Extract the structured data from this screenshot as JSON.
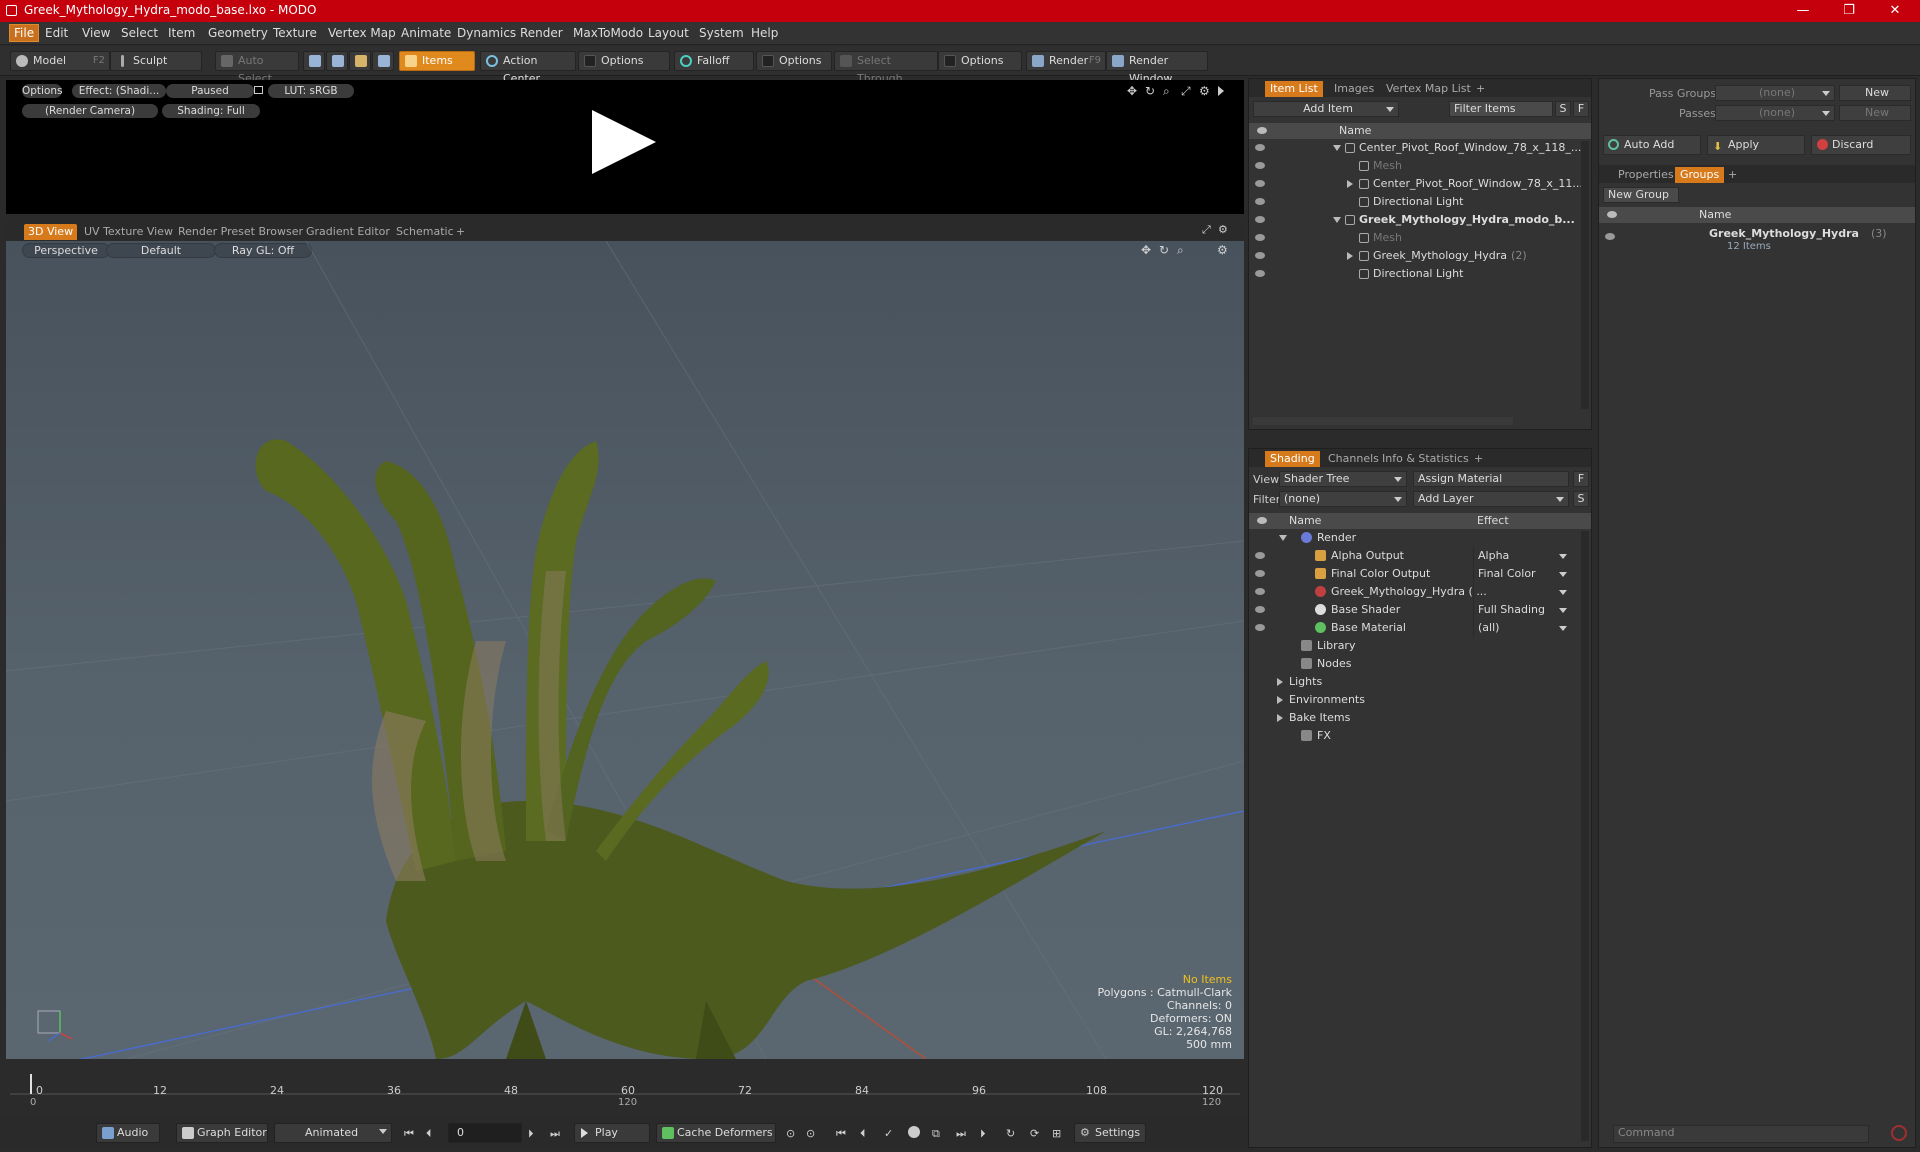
{
  "window": {
    "title": "Greek_Mythology_Hydra_modo_base.lxo - MODO",
    "minimize": "—",
    "restore": "❐",
    "close": "✕"
  },
  "menu": [
    "File",
    "Edit",
    "View",
    "Select",
    "Item",
    "Geometry",
    "Texture",
    "Vertex Map",
    "Animate",
    "Dynamics",
    "Render",
    "MaxToModo",
    "Layout",
    "System",
    "Help"
  ],
  "toolbar": {
    "model": "Model",
    "model_key": "F2",
    "sculpt": "Sculpt",
    "auto_select": "Auto Select",
    "items": "Items",
    "action_center": "Action Center",
    "options1": "Options",
    "falloff": "Falloff",
    "options2": "Options",
    "select_through": "Select Through",
    "options3": "Options",
    "render": "Render",
    "render_key": "F9",
    "render_window": "Render Window"
  },
  "preview": {
    "options": "Options",
    "effect": "Effect: (Shadi...",
    "paused": "Paused",
    "lut": "LUT: sRGB",
    "camera": "(Render Camera)",
    "shading": "Shading: Full"
  },
  "view_tabs": [
    "3D View",
    "UV Texture View",
    "Render Preset Browser",
    "Gradient Editor",
    "Schematic",
    "+"
  ],
  "viewport": {
    "perspective": "Perspective",
    "default": "Default",
    "raygl": "Ray GL: Off",
    "stats": {
      "no_items": "No Items",
      "polygons": "Polygons : Catmull-Clark",
      "channels": "Channels: 0",
      "deformers": "Deformers: ON",
      "gl": "GL: 2,264,768",
      "scale": "500 mm"
    }
  },
  "timeline": {
    "ticks": [
      "0",
      "12",
      "24",
      "36",
      "48",
      "60",
      "72",
      "84",
      "96",
      "108",
      "120"
    ],
    "start": "0",
    "mid": "120",
    "end": "120"
  },
  "bottom": {
    "audio": "Audio",
    "graph_editor": "Graph Editor",
    "animated": "Animated",
    "frame": "0",
    "play": "Play",
    "cache": "Cache Deformers",
    "settings": "Settings"
  },
  "item_list": {
    "tabs": [
      "Item List",
      "Images",
      "Vertex Map List",
      "+"
    ],
    "add_item": "Add Item",
    "filter_items": "Filter Items",
    "s": "S",
    "f": "F",
    "name_col": "Name",
    "rows": [
      {
        "label": "Center_Pivot_Roof_Window_78_x_118_...",
        "indent": 1,
        "bold": false
      },
      {
        "label": "Mesh",
        "indent": 2,
        "bold": false,
        "dim": true
      },
      {
        "label": "Center_Pivot_Roof_Window_78_x_11...",
        "indent": 2,
        "bold": false
      },
      {
        "label": "Directional Light",
        "indent": 2,
        "bold": false
      },
      {
        "label": "Greek_Mythology_Hydra_modo_b...",
        "indent": 1,
        "bold": true
      },
      {
        "label": "Mesh",
        "indent": 2,
        "bold": false,
        "dim": true
      },
      {
        "label": "Greek_Mythology_Hydra",
        "suffix": "(2)",
        "indent": 2,
        "bold": false
      },
      {
        "label": "Directional Light",
        "indent": 2,
        "bold": false
      }
    ]
  },
  "shading": {
    "tabs": [
      "Shading",
      "Channels",
      "Info & Statistics",
      "+"
    ],
    "view_label": "View",
    "view_value": "Shader Tree",
    "assign": "Assign Material",
    "f": "F",
    "filter_label": "Filter",
    "filter_value": "(none)",
    "add_layer": "Add Layer",
    "s": "S",
    "col_name": "Name",
    "col_effect": "Effect",
    "rows": [
      {
        "label": "Render",
        "effect": "",
        "indent": 0
      },
      {
        "label": "Alpha Output",
        "effect": "Alpha",
        "indent": 1
      },
      {
        "label": "Final Color Output",
        "effect": "Final Color",
        "indent": 1
      },
      {
        "label": "Greek_Mythology_Hydra ( ...",
        "effect": "",
        "indent": 1
      },
      {
        "label": "Base Shader",
        "effect": "Full Shading",
        "indent": 1
      },
      {
        "label": "Base Material",
        "effect": "(all)",
        "indent": 1
      },
      {
        "label": "Library",
        "effect": "",
        "indent": 0
      },
      {
        "label": "Nodes",
        "effect": "",
        "indent": 0
      },
      {
        "label": "Lights",
        "effect": "",
        "indent": -1
      },
      {
        "label": "Environments",
        "effect": "",
        "indent": -1
      },
      {
        "label": "Bake Items",
        "effect": "",
        "indent": -1
      },
      {
        "label": "FX",
        "effect": "",
        "indent": 0
      }
    ]
  },
  "groups": {
    "pass_groups": "Pass Groups",
    "pass_value": "(none)",
    "new": "New",
    "passes": "Passes",
    "passes_value": "(none)",
    "new2": "New",
    "auto_add": "Auto Add",
    "apply": "Apply",
    "discard": "Discard",
    "tabs": [
      "Properties",
      "Groups",
      "+"
    ],
    "new_group": "New Group",
    "name_col": "Name",
    "group_name": "Greek_Mythology_Hydra",
    "group_count": "(3)",
    "group_items": "12 Items"
  },
  "command": {
    "placeholder": "Command"
  }
}
